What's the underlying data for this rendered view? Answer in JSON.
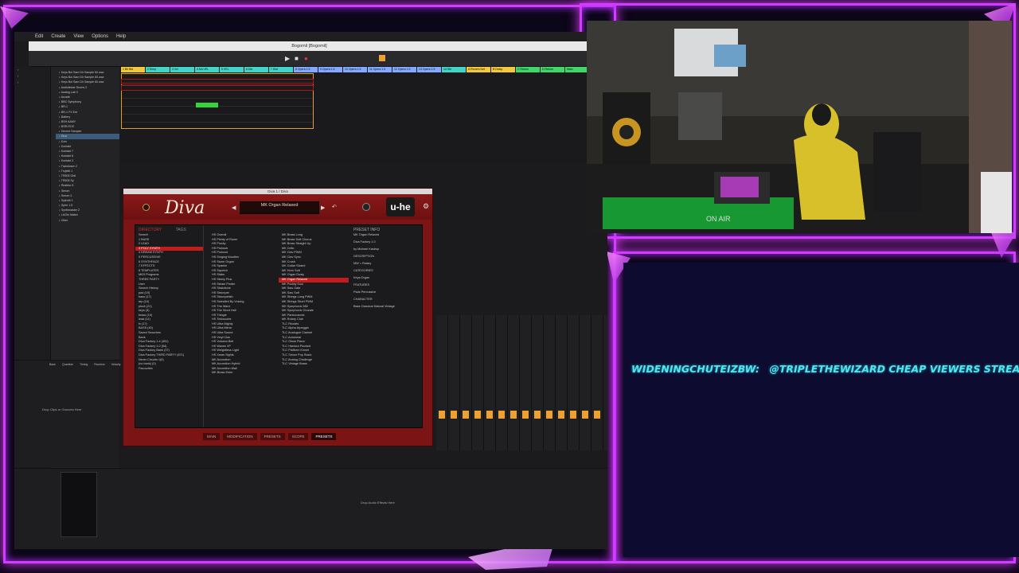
{
  "daw": {
    "menu": [
      "Edit",
      "Create",
      "View",
      "Options",
      "Help"
    ],
    "window_title": "Bogomil  [Bogomil]",
    "tracks": [
      {
        "name": "1 Bh Bld",
        "color": "#f2c83c"
      },
      {
        "name": "2 Simp",
        "color": "#3fd6c8"
      },
      {
        "name": "3 Vel",
        "color": "#3fd6c8"
      },
      {
        "name": "4 NA VEL",
        "color": "#3fd6c8"
      },
      {
        "name": "5 VEL",
        "color": "#3fd6c8"
      },
      {
        "name": "6 Dkt",
        "color": "#3fd6c8"
      },
      {
        "name": "7 Dist",
        "color": "#3fd6c8"
      },
      {
        "name": "8 Opera 1.5",
        "color": "#82a8ff"
      },
      {
        "name": "9 Opera 1.5",
        "color": "#82a8ff"
      },
      {
        "name": "10 Opera 1.5",
        "color": "#82a8ff"
      },
      {
        "name": "11 Opera 1.5",
        "color": "#82a8ff"
      },
      {
        "name": "12 Opera 1.5",
        "color": "#82a8ff"
      },
      {
        "name": "13 Opera 1.5",
        "color": "#82a8ff"
      },
      {
        "name": "14 Stri",
        "color": "#3fd6c8"
      },
      {
        "name": "A Reverb-Net",
        "color": "#f2c83c"
      },
      {
        "name": "B Delay",
        "color": "#f2c83c"
      },
      {
        "name": "C Return",
        "color": "#3fd66a"
      },
      {
        "name": "D Return",
        "color": "#3fd66a"
      },
      {
        "name": "Main",
        "color": "#3fd66a"
      }
    ],
    "browser_items": [
      "Keys Boi Sam Dir Sample 60.wav",
      "Keys Boi Sam Dir Sample 60.wav",
      "Keys Boi Sam Dir Sample 60.wav",
      "Audiolinear Drums 2",
      "Analog Lab V",
      "Arcade",
      "BBC Symphony",
      "BR-1",
      "BR-1 FX Ent",
      "Battery",
      "BSH AAMY",
      "BSR-RCE",
      "Decent Sampler",
      "Diva",
      "Ezin",
      "Kontakt",
      "Kontakt 7",
      "Kontakt 8",
      "Kontakt 3",
      "Transfuser 2",
      "Trcjekit 1",
      "TR505 Gbit",
      "TR505 Sy",
      "Reaktor 6",
      "Serum",
      "Serum 2",
      "Sylenth 1",
      "Spire 1.5",
      "Synthmaster 2",
      "LAGIn Matrix",
      "Viber"
    ],
    "detail_headers": [
      "Base",
      "Quantize",
      "Timing",
      "Random",
      "Velocity"
    ],
    "drop_clips_text": "Drop Clips or Grooves Here",
    "drop_effects_text": "Drop Audio Effects Here"
  },
  "diva": {
    "window_title": "Diva 1 / Diva",
    "logo": "Diva",
    "brand": "u-he",
    "preset_name": "MK Organ Relaxed",
    "panel_tabs": [
      "DIRECTORY",
      "TAGS"
    ],
    "preset_info_label": "PRESET INFO",
    "bottom_tabs": [
      "MAIN",
      "MODIFICATION",
      "PRESETS",
      "SCOPE",
      "PRESETS"
    ],
    "directory": [
      "Search",
      "1 BASS",
      "2 LEAD",
      "3 POLY SYNTH",
      "4 DREAM SYNTH",
      "5 PERCUSSIVE",
      "6 SYNTHFACE",
      "7 EFFECTS",
      "8 TEMPLATES",
      "MIDI Programs",
      "THREE PARTY",
      "User",
      "Search History",
      "pad (19)",
      "bass (17)",
      "arp (10)",
      "pluck (21)",
      "keys (3)",
      "brass (19)",
      "lead (11)",
      "fx (17)",
      "BASS (40)",
      "Saved Searches",
      "Bank",
      "Diva Factory 1.4 (451)",
      "Diva Factory 1.0 (54)",
      "Diva Factory Bank (37)",
      "Diva Factory THIRD PARTY (871)",
      "Never Circuits 1(5)",
      "(no bank) (0)",
      "Favourites"
    ],
    "selected_dir": "3 POLY SYNTH",
    "presets_a": [
      "HS Overall",
      "HS Plenty of Room",
      "HS Plucky",
      "HS Prutwub",
      "HS Protocol",
      "HS Singing Noodles",
      "HS Stone Organ",
      "HS Sparkle",
      "HS Squelch",
      "HS Stabs",
      "HS Steely Plus",
      "HS Steam Pinder",
      "HS Stratotone",
      "HS Strumpet",
      "HS Strumpetish",
      "HS Swindled By Voicing",
      "HS The Ward",
      "HS The Word Hall",
      "HS Thingie",
      "HS Tinkwoofer",
      "HS Ultra Mighty",
      "HS Ultra Mirror",
      "HS Ultra Sound",
      "HS Vinyl Clav",
      "HS Volcano Bell",
      "HS Waves VP",
      "HS Weightless Light",
      "HS Xmas Sights",
      "MK Accordion",
      "MK Accordion Hybrid",
      "MK Accordion Wall",
      "MK Brass Eerie"
    ],
    "presets_b": [
      "MK Brass Long",
      "MK Brass Soft Chorus",
      "MK Brass Straight Up",
      "MK Cello",
      "MK Clav PWM",
      "MK Clav Sync",
      "MK Crush",
      "MK Guitar Strand",
      "MK Horn Soft",
      "MK Organ Dualy",
      "MK Organ Relaxed",
      "MK Poolay Soul",
      "MK Saw Gate",
      "MK Saw Soft",
      "MK Strings Long PWM",
      "MK Strings Short PWM",
      "MK Symphonic 852",
      "MK Symphonic Chorale",
      "MK Pantocosmic",
      "MK Rotary Club",
      "TLC Rhodes",
      "TLC Alpha Arpeggio",
      "TLC Analogue Clarinet",
      "TLC Autumnal",
      "TLC Gloss Piano",
      "TLC Hardcut Plucked",
      "TLC Platform Kinnet",
      "TLC Simon Pop Stack",
      "TLC Analog Challenge",
      "TLC Vintage Brass"
    ],
    "selected_preset": "MK Organ Relaxed",
    "info": [
      "MK Organ Relaxed",
      "Diva Factory 1.0",
      "by Michael Kastrup",
      "DESCRIPTION",
      "MW = Rotary",
      "CATEGORIES",
      "Keys:Organ",
      "FEATURES",
      "Pads  Percussive",
      "CHARACTER",
      "Bass  Classical  Natural  Vintage"
    ]
  },
  "chat": {
    "username": "WIDENINGCHUTEIZBW:",
    "message": "@TRIPLETHEWIZARD CHEAP VIEWERS STREAMBOO .COM (R"
  },
  "colors": {
    "frame": "#d33cff",
    "chat_text": "#4fe6ef",
    "chat_bg": "#0e0b30",
    "diva_red": "#7b1414"
  }
}
